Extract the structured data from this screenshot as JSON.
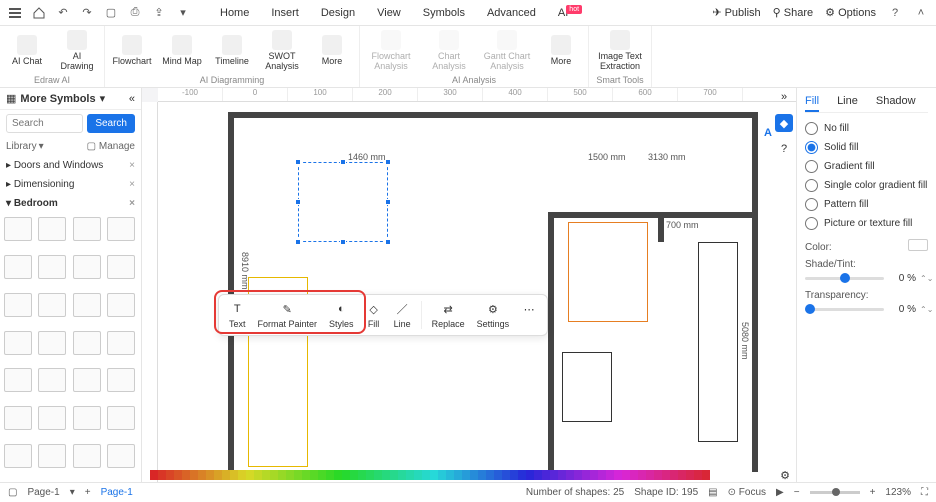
{
  "titlebar": {
    "menu": [
      "Home",
      "Insert",
      "Design",
      "View",
      "Symbols",
      "Advanced",
      "AI"
    ],
    "hot": "hot",
    "publish": "Publish",
    "share": "Share",
    "options": "Options"
  },
  "ribbon": {
    "g1": {
      "items": [
        {
          "l": "AI Chat"
        },
        {
          "l": "AI Drawing"
        }
      ],
      "label": "Edraw AI"
    },
    "g2": {
      "items": [
        {
          "l": "Flowchart"
        },
        {
          "l": "Mind Map"
        },
        {
          "l": "Timeline"
        },
        {
          "l": "SWOT Analysis"
        },
        {
          "l": "More"
        }
      ],
      "label": "AI Diagramming"
    },
    "g3": {
      "items": [
        {
          "l": "Flowchart Analysis"
        },
        {
          "l": "Chart Analysis"
        },
        {
          "l": "Gantt Chart Analysis"
        },
        {
          "l": "More"
        }
      ],
      "label": "AI Analysis"
    },
    "g4": {
      "items": [
        {
          "l": "Image Text Extraction"
        }
      ],
      "label": "Smart Tools"
    }
  },
  "leftpanel": {
    "more_symbols": "More Symbols",
    "search_ph": "Search",
    "search_btn": "Search",
    "library": "Library",
    "manage": "Manage",
    "cats": [
      {
        "name": "Doors and Windows"
      },
      {
        "name": "Dimensioning"
      },
      {
        "name": "Bedroom",
        "active": true
      }
    ]
  },
  "ctx": {
    "items": [
      "Text",
      "Format Painter",
      "Styles",
      "Fill",
      "Line",
      "Replace",
      "Settings"
    ]
  },
  "rightpanel": {
    "tabs": [
      "Fill",
      "Line",
      "Shadow"
    ],
    "opts": [
      "No fill",
      "Solid fill",
      "Gradient fill",
      "Single color gradient fill",
      "Pattern fill",
      "Picture or texture fill"
    ],
    "selected_opt": 1,
    "color_label": "Color:",
    "shade_label": "Shade/Tint:",
    "shade_val": "0 %",
    "trans_label": "Transparency:",
    "trans_val": "0 %"
  },
  "dimensions": {
    "d1": "1460 mm",
    "d2": "1500 mm",
    "d3": "3130 mm",
    "d4": "700 mm",
    "d5": "8910 mm",
    "d6": "5080 mm"
  },
  "ruler_marks": [
    "-100",
    "0",
    "100",
    "200",
    "300",
    "400",
    "500",
    "600",
    "700"
  ],
  "status": {
    "page_a": "Page-1",
    "page_b": "Page-1",
    "shapes": "Number of shapes: 25",
    "shape_id": "Shape ID: 195",
    "focus": "Focus",
    "zoom": "123%"
  }
}
